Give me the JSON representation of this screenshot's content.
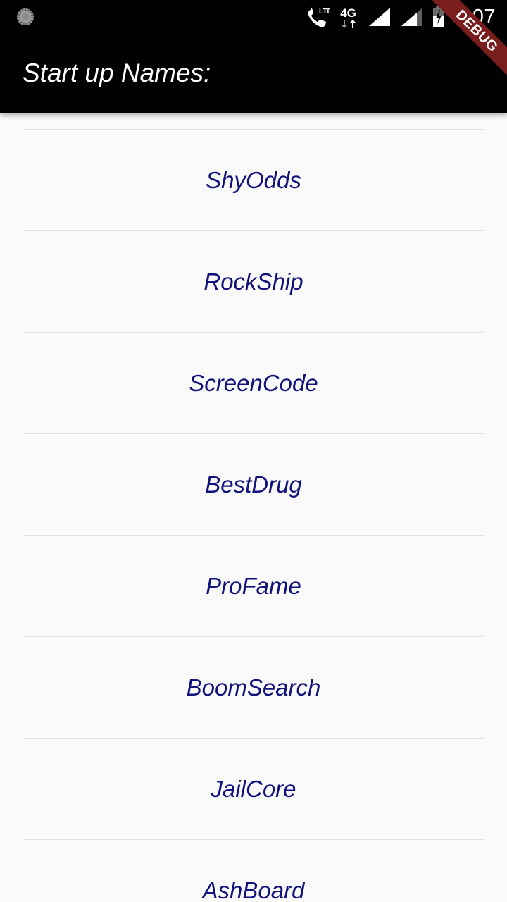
{
  "status_bar": {
    "left_icon": "loading-spinner-icon",
    "icons": [
      "phone-lte-icon",
      "4g-data-icon",
      "signal-icon",
      "signal-icon-2",
      "battery-icon"
    ],
    "phone_badge": "LTE",
    "network_label": "4G",
    "time": "4:07"
  },
  "app_bar": {
    "title": "Start up Names:"
  },
  "debug_banner": {
    "label": "DEBUG",
    "color": "#7a1d1d"
  },
  "colors": {
    "app_bar_bg": "#000000",
    "list_bg": "#fafafa",
    "item_text": "#12127c",
    "divider": "#e3e3e3"
  },
  "list": {
    "items": [
      {
        "label": "ShyOdds"
      },
      {
        "label": "RockShip"
      },
      {
        "label": "ScreenCode"
      },
      {
        "label": "BestDrug"
      },
      {
        "label": "ProFame"
      },
      {
        "label": "BoomSearch"
      },
      {
        "label": "JailCore"
      },
      {
        "label": "AshBoard"
      }
    ]
  }
}
